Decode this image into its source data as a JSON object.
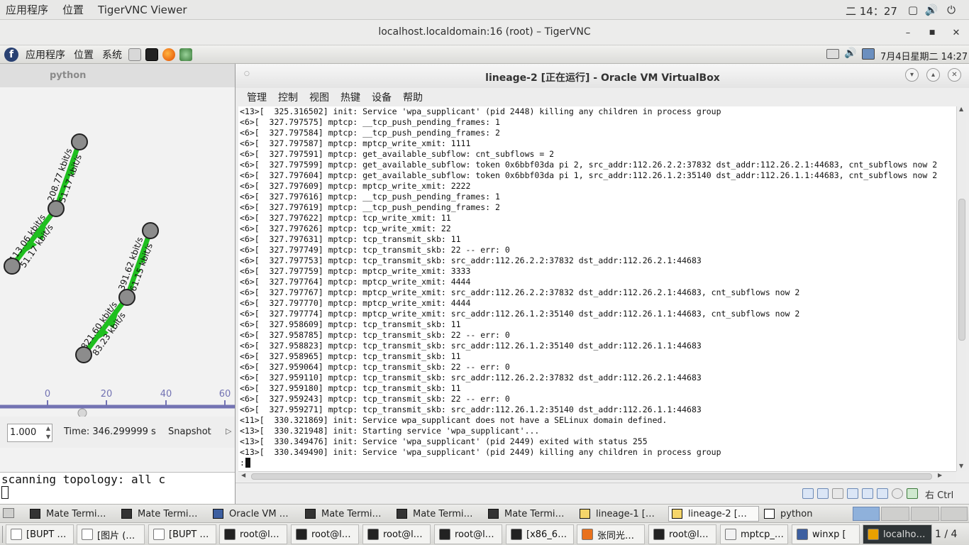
{
  "host_topbar": {
    "menu_apps": "应用程序",
    "menu_places": "位置",
    "app_name": "TigerVNC Viewer",
    "clock": "二 14：27"
  },
  "vnc_window": {
    "title": "localhost.localdomain:16 (root) – TigerVNC",
    "min": "–",
    "max": "■",
    "close": "✕"
  },
  "guest_panel": {
    "menu_apps": "应用程序",
    "menu_places": "位置",
    "menu_system": "系统",
    "datetime": "7月4日星期二 14:27"
  },
  "python_window": {
    "title": "python",
    "speed_value": "1.000",
    "time_label": "Time: 346.299999 s",
    "snapshot_label": "Snapshot",
    "axis_ticks": [
      "0",
      "20",
      "40",
      "60"
    ],
    "links": [
      {
        "forward": "113.06 kbit/s",
        "back": "51.17 kbit/s"
      },
      {
        "forward": "208.77 kbit/s",
        "back": "51.17 kbit/s"
      },
      {
        "forward": "821.60 kbit/s",
        "back": "83.23 kbit/s"
      },
      {
        "forward": "391.62 kbit/s",
        "back": "61.15 kbit/s"
      }
    ]
  },
  "terminal_left": {
    "line": "scanning topology: all c"
  },
  "vbox_window": {
    "title": "lineage-2 [正在运行] - Oracle VM VirtualBox",
    "menu": [
      "管理",
      "控制",
      "视图",
      "热键",
      "设备",
      "帮助"
    ],
    "host_key": "右 Ctrl",
    "console_lines": [
      "<13>[  325.316502] init: Service 'wpa_supplicant' (pid 2448) killing any children in process group",
      "<6>[  327.797575] mptcp: __tcp_push_pending_frames: 1",
      "<6>[  327.797584] mptcp: __tcp_push_pending_frames: 2",
      "<6>[  327.797587] mptcp: mptcp_write_xmit: 1111",
      "<6>[  327.797591] mptcp: get_available_subflow: cnt_subflows = 2",
      "<6>[  327.797599] mptcp: get_available_subflow: token 0x6bbf03da pi 2, src_addr:112.26.2.2:37832 dst_addr:112.26.2.1:44683, cnt_subflows now 2",
      "<6>[  327.797604] mptcp: get_available_subflow: token 0x6bbf03da pi 1, src_addr:112.26.1.2:35140 dst_addr:112.26.1.1:44683, cnt_subflows now 2",
      "<6>[  327.797609] mptcp: mptcp_write_xmit: 2222",
      "<6>[  327.797616] mptcp: __tcp_push_pending_frames: 1",
      "<6>[  327.797619] mptcp: __tcp_push_pending_frames: 2",
      "<6>[  327.797622] mptcp: tcp_write_xmit: 11",
      "<6>[  327.797626] mptcp: tcp_write_xmit: 22",
      "<6>[  327.797631] mptcp: tcp_transmit_skb: 11",
      "<6>[  327.797749] mptcp: tcp_transmit_skb: 22 -- err: 0",
      "<6>[  327.797753] mptcp: tcp_transmit_skb: src_addr:112.26.2.2:37832 dst_addr:112.26.2.1:44683",
      "<6>[  327.797759] mptcp: mptcp_write_xmit: 3333",
      "<6>[  327.797764] mptcp: mptcp_write_xmit: 4444",
      "<6>[  327.797767] mptcp: mptcp_write_xmit: src_addr:112.26.2.2:37832 dst_addr:112.26.2.1:44683, cnt_subflows now 2",
      "<6>[  327.797770] mptcp: mptcp_write_xmit: 4444",
      "<6>[  327.797774] mptcp: mptcp_write_xmit: src_addr:112.26.1.2:35140 dst_addr:112.26.1.1:44683, cnt_subflows now 2",
      "<6>[  327.958609] mptcp: tcp_transmit_skb: 11",
      "<6>[  327.958785] mptcp: tcp_transmit_skb: 22 -- err: 0",
      "<6>[  327.958823] mptcp: tcp_transmit_skb: src_addr:112.26.1.2:35140 dst_addr:112.26.1.1:44683",
      "<6>[  327.958965] mptcp: tcp_transmit_skb: 11",
      "<6>[  327.959064] mptcp: tcp_transmit_skb: 22 -- err: 0",
      "<6>[  327.959110] mptcp: tcp_transmit_skb: src_addr:112.26.2.2:37832 dst_addr:112.26.2.1:44683",
      "<6>[  327.959180] mptcp: tcp_transmit_skb: 11",
      "<6>[  327.959243] mptcp: tcp_transmit_skb: 22 -- err: 0",
      "<6>[  327.959271] mptcp: tcp_transmit_skb: src_addr:112.26.1.2:35140 dst_addr:112.26.1.1:44683",
      "<11>[  330.321869] init: Service wpa_supplicant does not have a SELinux domain defined.",
      "<13>[  330.321948] init: Starting service 'wpa_supplicant'...",
      "<13>[  330.349476] init: Service 'wpa_supplicant' (pid 2449) exited with status 255",
      "<13>[  330.349490] init: Service 'wpa_supplicant' (pid 2449) killing any children in process group",
      ":"
    ]
  },
  "taskbar1": {
    "items": [
      {
        "label": "Mate Termi…",
        "icon": "terminal-icon"
      },
      {
        "label": "Mate Termi…",
        "icon": "terminal-icon"
      },
      {
        "label": "Oracle VM …",
        "icon": "virtualbox-icon"
      },
      {
        "label": "Mate Termi…",
        "icon": "terminal-icon"
      },
      {
        "label": "Mate Termi…",
        "icon": "terminal-icon"
      },
      {
        "label": "Mate Termi…",
        "icon": "terminal-icon"
      },
      {
        "label": "lineage-1 […",
        "icon": "vm-icon"
      },
      {
        "label": "lineage-2 […",
        "icon": "vm-icon"
      },
      {
        "label": "python",
        "icon": "window-icon"
      }
    ]
  },
  "taskbar2": {
    "items": [
      {
        "label": "[BUPT …",
        "icon": "document-icon"
      },
      {
        "label": "[图片 (…",
        "icon": "document-icon"
      },
      {
        "label": "[BUPT …",
        "icon": "document-icon"
      },
      {
        "label": "root@l…",
        "icon": "terminal-icon"
      },
      {
        "label": "root@l…",
        "icon": "terminal-icon"
      },
      {
        "label": "root@l…",
        "icon": "terminal-icon"
      },
      {
        "label": "root@l…",
        "icon": "terminal-icon"
      },
      {
        "label": "[x86_6…",
        "icon": "terminal-icon"
      },
      {
        "label": "张同光…",
        "icon": "firefox-icon"
      },
      {
        "label": "root@l…",
        "icon": "terminal-icon"
      },
      {
        "label": "mptcp_…",
        "icon": "text-editor-icon"
      },
      {
        "label": "winxp [",
        "icon": "virtualbox-icon"
      },
      {
        "label": "localho…",
        "icon": "vnc-icon"
      }
    ],
    "workspace": "1 / 4"
  },
  "colors": {
    "link_green": "#1fbf1f",
    "node_gray": "#8c8c8c",
    "axis_blue": "#7373b3"
  }
}
